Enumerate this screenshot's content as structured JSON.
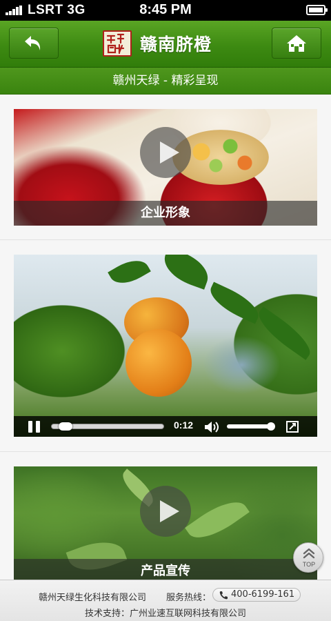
{
  "status_bar": {
    "carrier": "LSRT 3G",
    "time": "8:45 PM"
  },
  "header": {
    "title": "赣南脐橙",
    "logo": "seal-logo"
  },
  "subheader": {
    "text": "赣州天绿 - 精彩呈现"
  },
  "items": [
    {
      "caption": "企业形象",
      "type": "video-thumbnail"
    },
    {
      "type": "video-player",
      "current_time": "0:12",
      "progress": 0.06,
      "volume": 1.0
    },
    {
      "caption": "产品宣传",
      "type": "video-thumbnail"
    }
  ],
  "top_button": {
    "label": "TOP"
  },
  "footer": {
    "company": "赣州天绿生化科技有限公司",
    "hotline_label": "服务热线：",
    "phone": "400-6199-161",
    "support": "技术支持：广州业速互联网科技有限公司"
  },
  "colors": {
    "header_green": "#3d8a12",
    "seal_red": "#b0201b"
  }
}
